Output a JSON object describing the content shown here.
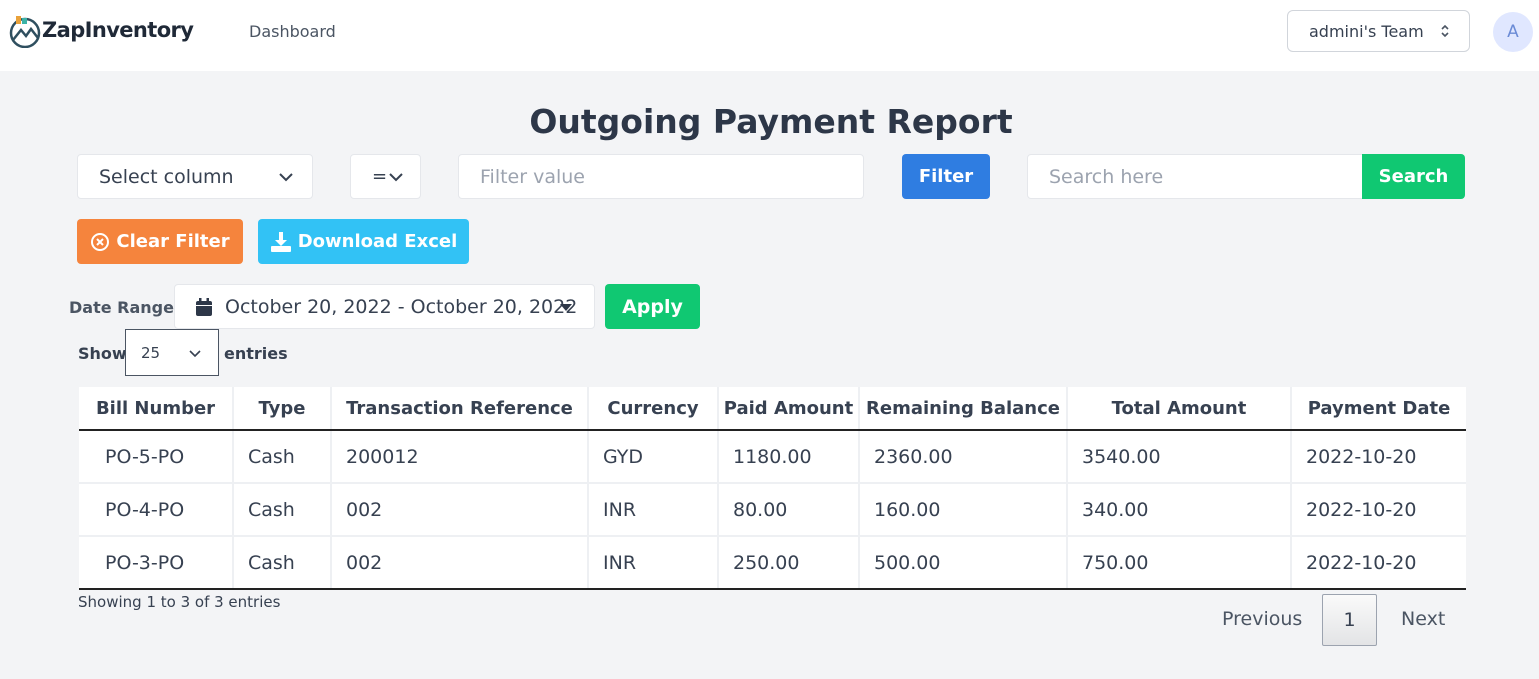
{
  "header": {
    "brand": "ZapInventory",
    "nav_dashboard": "Dashboard",
    "team": "admini's Team",
    "avatar_initial": "A"
  },
  "page": {
    "title": "Outgoing Payment Report"
  },
  "filters": {
    "column_select": "Select column",
    "operator": "=",
    "filter_placeholder": "Filter value",
    "filter_button": "Filter",
    "search_placeholder": "Search here",
    "search_button": "Search",
    "clear_button": "Clear Filter",
    "download_button": "Download Excel",
    "date_label": "Date Range:",
    "date_range": "October 20, 2022 - October 20, 2022",
    "apply_button": "Apply"
  },
  "length": {
    "show_label": "Show",
    "value": "25",
    "entries_label": "entries"
  },
  "table": {
    "columns": [
      "Bill Number",
      "Type",
      "Transaction Reference",
      "Currency",
      "Paid Amount",
      "Remaining Balance",
      "Total Amount",
      "Payment Date"
    ],
    "rows": [
      [
        "PO-5-PO",
        "Cash",
        "200012",
        "GYD",
        "1180.00",
        "2360.00",
        "3540.00",
        "2022-10-20"
      ],
      [
        "PO-4-PO",
        "Cash",
        "002",
        "INR",
        "80.00",
        "160.00",
        "340.00",
        "2022-10-20"
      ],
      [
        "PO-3-PO",
        "Cash",
        "002",
        "INR",
        "250.00",
        "500.00",
        "750.00",
        "2022-10-20"
      ]
    ]
  },
  "footer": {
    "showing": "Showing 1 to 3 of 3 entries",
    "previous": "Previous",
    "page": "1",
    "next": "Next"
  },
  "colors": {
    "filter_button": "#2f7de1",
    "search_button": "#10c872",
    "clear_button": "#f5843d",
    "download_button": "#32c2f5",
    "apply_button": "#10c872"
  }
}
